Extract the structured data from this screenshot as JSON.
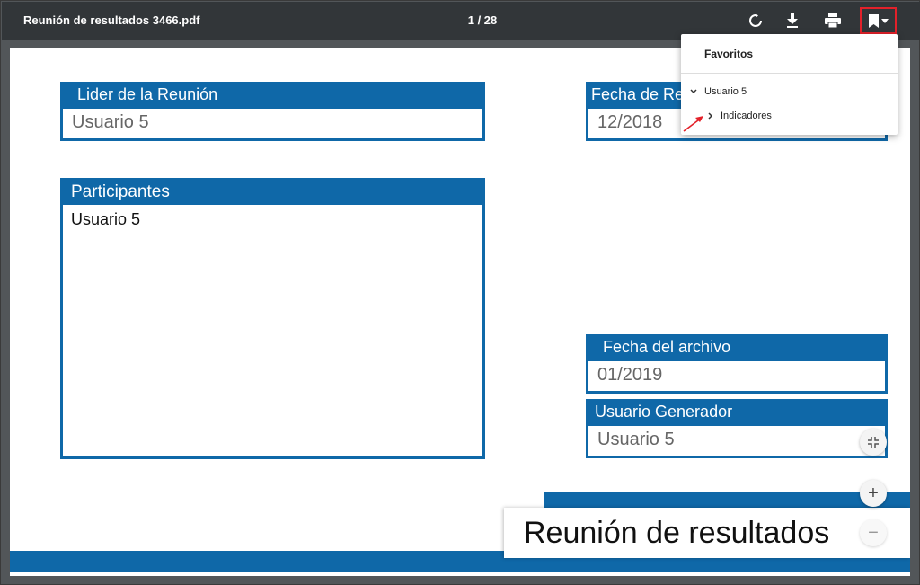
{
  "toolbar": {
    "title": "Reunión de resultados 3466.pdf",
    "page_indicator": "1 / 28",
    "icons": [
      "rotate-icon",
      "download-icon",
      "print-icon",
      "bookmark-icon"
    ]
  },
  "bookmarks": {
    "header": "Favoritos",
    "items": [
      {
        "label": "Usuario 5",
        "expanded": true
      },
      {
        "label": "Indicadores",
        "expanded": false
      }
    ]
  },
  "document": {
    "leader": {
      "header": "Lider de la Reunión",
      "value": "Usuario 5"
    },
    "meeting_date": {
      "header": "Fecha de Re",
      "value": "12/2018"
    },
    "participants": {
      "header": "Participantes",
      "value": "Usuario 5"
    },
    "file_date": {
      "header": "Fecha del archivo",
      "value": "01/2019"
    },
    "generator": {
      "header": "Usuario Generador",
      "value": "Usuario 5"
    },
    "title": "Reunión de resultados"
  },
  "colors": {
    "accent": "#0f68a8",
    "toolbar": "#323639",
    "highlight": "#e3212a"
  }
}
